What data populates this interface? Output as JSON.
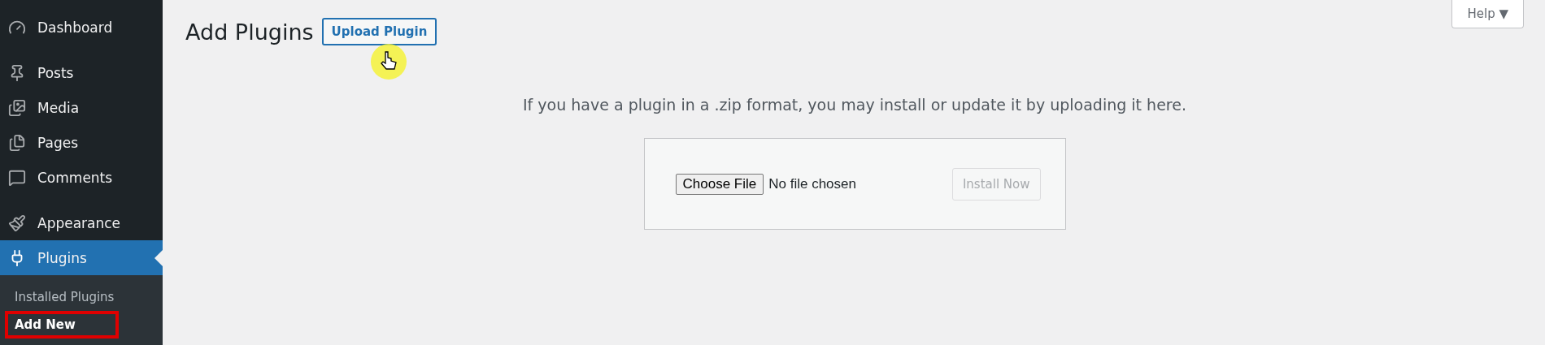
{
  "sidebar": {
    "groups": [
      [
        {
          "label": "Dashboard",
          "selected": false
        }
      ],
      [
        {
          "label": "Posts",
          "selected": false
        },
        {
          "label": "Media",
          "selected": false
        },
        {
          "label": "Pages",
          "selected": false
        },
        {
          "label": "Comments",
          "selected": false
        }
      ],
      [
        {
          "label": "Appearance",
          "selected": false
        },
        {
          "label": "Plugins",
          "selected": true
        }
      ]
    ],
    "submenu": [
      {
        "label": "Installed Plugins",
        "selected": false,
        "highlighted": false
      },
      {
        "label": "Add New",
        "selected": true,
        "highlighted": true
      }
    ]
  },
  "header": {
    "title": "Add Plugins",
    "upload_button": "Upload Plugin",
    "help": "Help ▼"
  },
  "upload": {
    "description": "If you have a plugin in a .zip format, you may install or update it by uploading it here.",
    "choose_file": "Choose File",
    "file_status": "No file chosen",
    "install_button": "Install Now",
    "install_disabled": true
  }
}
